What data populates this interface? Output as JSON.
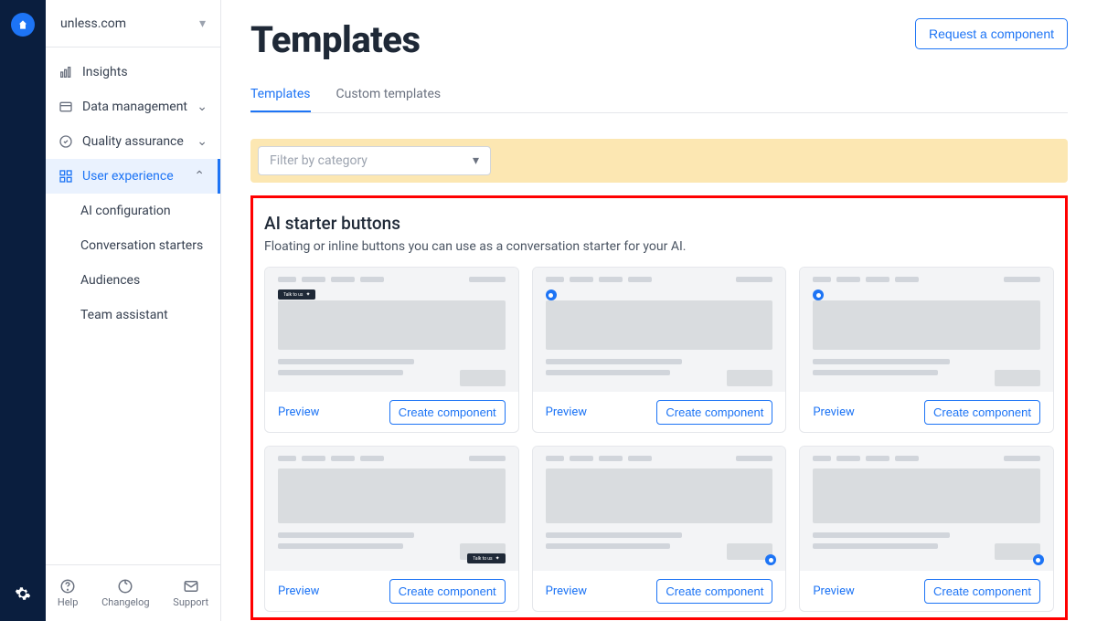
{
  "org": "unless.com",
  "nav": {
    "insights": "Insights",
    "data_management": "Data management",
    "quality_assurance": "Quality assurance",
    "user_experience": "User experience",
    "subs": {
      "ai_config": "AI configuration",
      "conv_starters": "Conversation starters",
      "audiences": "Audiences",
      "team_assistant": "Team assistant"
    }
  },
  "footer": {
    "help": "Help",
    "changelog": "Changelog",
    "support": "Support"
  },
  "page": {
    "title": "Templates",
    "request_btn": "Request a component",
    "tabs": {
      "templates": "Templates",
      "custom": "Custom templates"
    },
    "filter_placeholder": "Filter by category"
  },
  "section": {
    "title": "AI starter buttons",
    "desc": "Floating or inline buttons you can use as a conversation starter for your AI."
  },
  "card": {
    "preview": "Preview",
    "create": "Create component"
  }
}
